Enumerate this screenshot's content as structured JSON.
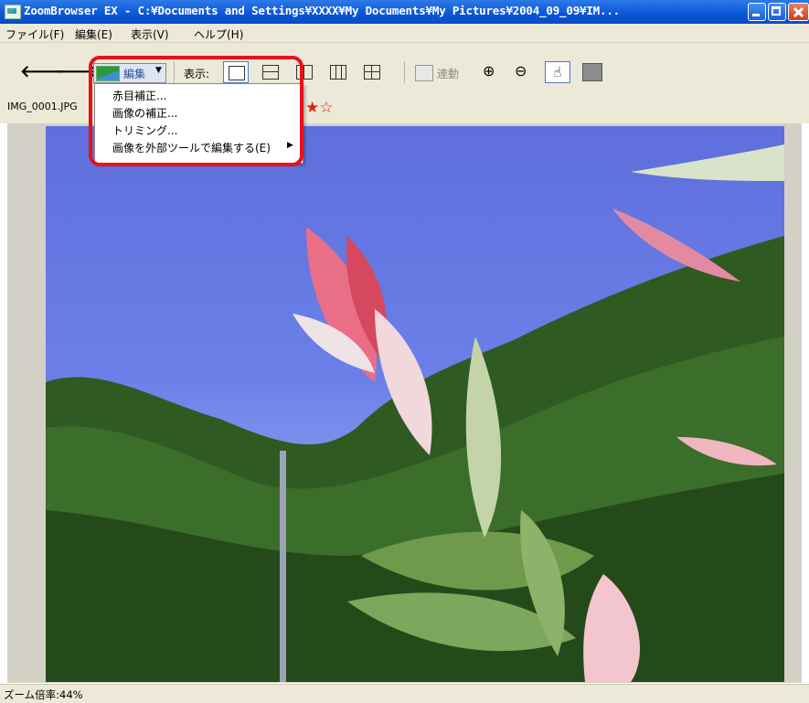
{
  "window": {
    "title": "ZoomBrowser EX - C:¥Documents and Settings¥XXXX¥My Documents¥My Pictures¥2004_09_09¥IM..."
  },
  "menubar": {
    "items": [
      "ファイル(F)",
      "編集(E)",
      "表示(V)",
      "ヘルプ(H)"
    ]
  },
  "toolbar": {
    "back_icon": "left-arrow-icon",
    "forward_icon": "right-arrow-icon",
    "edit_label": "編集",
    "view_label": "表示:",
    "link_label": "連動",
    "zoom_in_icon": "zoom-in-icon",
    "zoom_out_icon": "zoom-out-icon",
    "hand_icon": "hand-tool-icon"
  },
  "file": {
    "name": "IMG_0001.JPG"
  },
  "edit_menu": {
    "items": [
      "赤目補正...",
      "画像の補正...",
      "トリミング...",
      "画像を外部ツールで編集する(E)"
    ]
  },
  "status": {
    "zoom_text": "ズーム倍率:44%"
  },
  "colors": {
    "titlebar": "#0a55d8",
    "chrome": "#ece9d8",
    "highlight": "#e8101a"
  }
}
